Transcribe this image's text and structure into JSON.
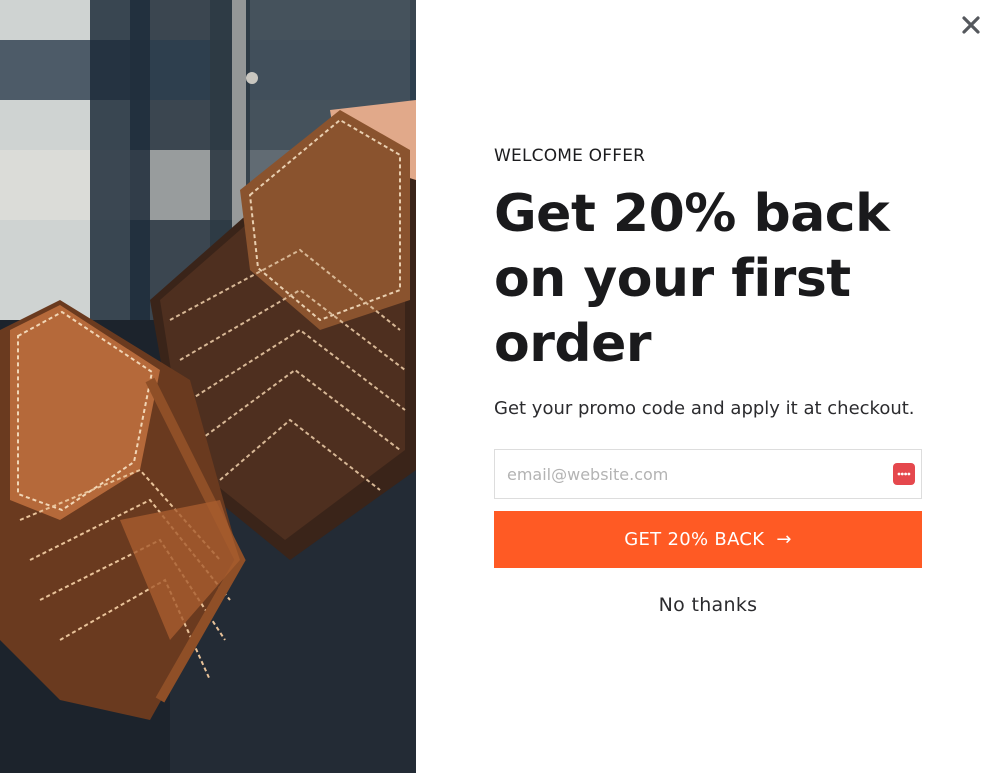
{
  "popup": {
    "eyebrow": "WELCOME OFFER",
    "headline": "Get 20% back on your first order",
    "subtext": "Get your promo code and apply it at checkout.",
    "email_placeholder": "email@website.com",
    "email_value": "",
    "cta_label": "GET 20% BACK",
    "cta_arrow": "→",
    "dismiss_label": "No thanks",
    "close_icon": "close-icon",
    "password_manager_icon": "password-manager-icon"
  },
  "colors": {
    "accent": "#ff5a24",
    "password_badge": "#e5484d",
    "text": "#1a1a1c"
  }
}
